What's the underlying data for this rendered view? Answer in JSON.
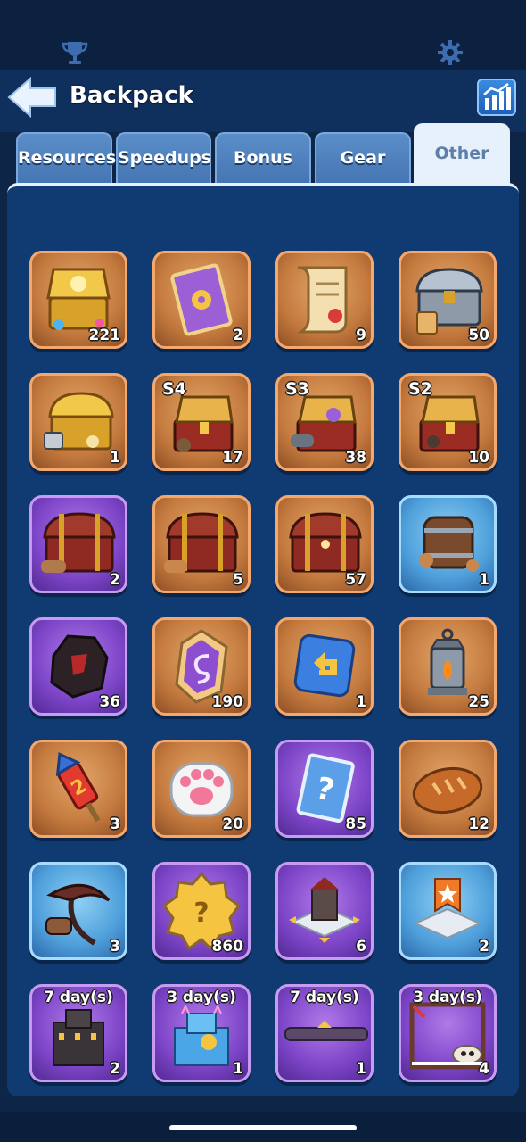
{
  "top_bar": {
    "icons": [
      "trophy-icon",
      "gear-icon"
    ]
  },
  "header": {
    "title": "Backpack",
    "back_icon": "back-arrow-icon",
    "stats_icon": "stats-icon"
  },
  "tabs": [
    {
      "label": "Resources"
    },
    {
      "label": "Speedups"
    },
    {
      "label": "Bonus"
    },
    {
      "label": "Gear"
    },
    {
      "label": "Other",
      "active": true
    }
  ],
  "items": [
    {
      "icon": "gold-treasure-chest-icon",
      "rarity": "orange",
      "count": "221"
    },
    {
      "icon": "purple-card-icon",
      "rarity": "orange",
      "count": "2"
    },
    {
      "icon": "scroll-icon",
      "rarity": "orange",
      "count": "9"
    },
    {
      "icon": "silver-chest-icon",
      "rarity": "orange",
      "count": "50"
    },
    {
      "icon": "gold-chest-icon",
      "rarity": "orange",
      "count": "1"
    },
    {
      "icon": "season-chest-icon",
      "rarity": "orange",
      "season": "S4",
      "count": "17"
    },
    {
      "icon": "season-chest-icon",
      "rarity": "orange",
      "season": "S3",
      "count": "38"
    },
    {
      "icon": "season-chest-icon",
      "rarity": "orange",
      "season": "S2",
      "count": "10"
    },
    {
      "icon": "red-chest-icon",
      "rarity": "purple",
      "count": "2"
    },
    {
      "icon": "red-chest-icon",
      "rarity": "orange",
      "count": "5"
    },
    {
      "icon": "red-chest-icon",
      "rarity": "orange",
      "count": "57"
    },
    {
      "icon": "barrel-chest-icon",
      "rarity": "blue",
      "count": "1"
    },
    {
      "icon": "dark-ore-icon",
      "rarity": "purple",
      "count": "36"
    },
    {
      "icon": "rune-stone-icon",
      "rarity": "orange",
      "count": "190"
    },
    {
      "icon": "return-arrow-icon",
      "rarity": "orange",
      "count": "1"
    },
    {
      "icon": "lantern-icon",
      "rarity": "orange",
      "count": "25"
    },
    {
      "icon": "firework-icon",
      "rarity": "orange",
      "count": "3"
    },
    {
      "icon": "paw-cookie-icon",
      "rarity": "orange",
      "count": "20"
    },
    {
      "icon": "mystery-card-icon",
      "rarity": "purple",
      "count": "85"
    },
    {
      "icon": "bread-icon",
      "rarity": "orange",
      "count": "12"
    },
    {
      "icon": "scythe-icon",
      "rarity": "blue",
      "count": "3"
    },
    {
      "icon": "mystery-badge-icon",
      "rarity": "purple",
      "count": "860"
    },
    {
      "icon": "building-relocate-icon",
      "rarity": "purple",
      "count": "6"
    },
    {
      "icon": "banner-relocate-icon",
      "rarity": "blue",
      "count": "2"
    },
    {
      "icon": "castle-skin-icon",
      "rarity": "purple",
      "duration": "7 day(s)",
      "count": "2"
    },
    {
      "icon": "ice-castle-skin-icon",
      "rarity": "purple",
      "duration": "3 day(s)",
      "count": "1"
    },
    {
      "icon": "nameplate-icon",
      "rarity": "purple",
      "duration": "7 day(s)",
      "count": "1"
    },
    {
      "icon": "skull-frame-icon",
      "rarity": "purple",
      "duration": "3 day(s)",
      "count": "4"
    }
  ]
}
